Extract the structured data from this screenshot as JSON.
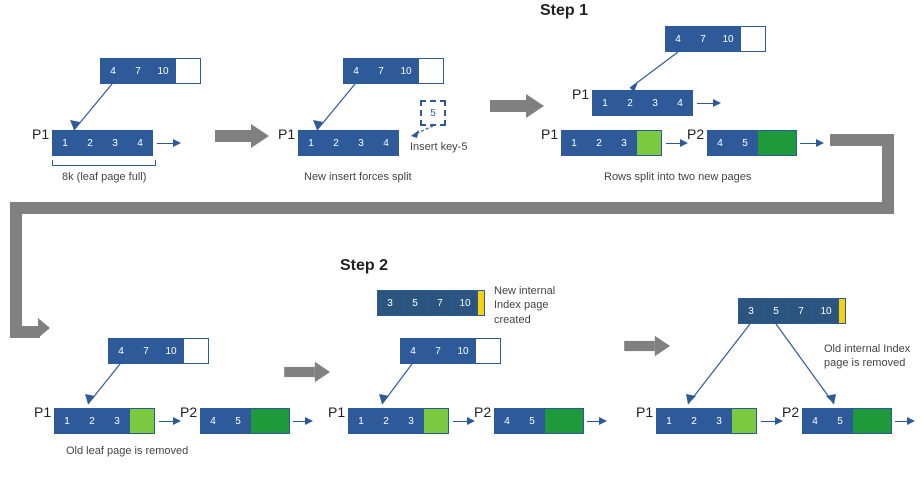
{
  "steps": {
    "step1": "Step 1",
    "step2": "Step 2"
  },
  "captions": {
    "c1": "8k (leaf page full)",
    "c2": "New insert forces split",
    "c3": "Rows split into two new pages",
    "c4": "Old leaf page is removed",
    "c5": "New internal\nIndex page\ncreated",
    "c6": "Old internal Index\npage is removed",
    "insert": "Insert key-5"
  },
  "labels": {
    "p1": "P1",
    "p2": "P2"
  },
  "cells": {
    "idx": {
      "a": "4",
      "b": "7",
      "c": "10"
    },
    "leaf4": {
      "a": "1",
      "b": "2",
      "c": "3",
      "d": "4"
    },
    "dash5": "5",
    "p1_3": {
      "a": "1",
      "b": "2",
      "c": "3"
    },
    "p2_2": {
      "a": "4",
      "b": "5"
    },
    "internal4": {
      "a": "3",
      "b": "5",
      "c": "7",
      "d": "10"
    }
  },
  "chart_data": {
    "type": "diagram",
    "title": "B-tree page split sequence",
    "stages": [
      {
        "group": "Step 1",
        "frames": [
          {
            "caption": "8k (leaf page full)",
            "internal_page": [
              4,
              7,
              10,
              null
            ],
            "leaf_pages": [
              {
                "id": "P1",
                "rows": [
                  1,
                  2,
                  3,
                  4
                ]
              }
            ]
          },
          {
            "caption": "New insert forces split",
            "internal_page": [
              4,
              7,
              10,
              null
            ],
            "leaf_pages": [
              {
                "id": "P1",
                "rows": [
                  1,
                  2,
                  3,
                  4
                ]
              }
            ],
            "pending_insert": 5,
            "note": "Insert key-5"
          },
          {
            "caption": "Rows split into two new pages",
            "internal_page": [
              4,
              7,
              10,
              null
            ],
            "old_leaf": {
              "id": "P1",
              "rows": [
                1,
                2,
                3,
                4
              ]
            },
            "leaf_pages": [
              {
                "id": "P1",
                "rows": [
                  1,
                  2,
                  3,
                  "new"
                ]
              },
              {
                "id": "P2",
                "rows": [
                  4,
                  5,
                  "new",
                  "new"
                ]
              }
            ]
          }
        ]
      },
      {
        "group": "Step 2",
        "frames": [
          {
            "caption": "Old leaf page is removed",
            "internal_page": [
              4,
              7,
              10,
              null
            ],
            "leaf_pages": [
              {
                "id": "P1",
                "rows": [
                  1,
                  2,
                  3,
                  "new"
                ]
              },
              {
                "id": "P2",
                "rows": [
                  4,
                  5,
                  "new",
                  "new"
                ]
              }
            ]
          },
          {
            "caption": "New internal Index page created",
            "new_internal_page": [
              3,
              5,
              7,
              10,
              "new"
            ],
            "old_internal_page": [
              4,
              7,
              10,
              null
            ],
            "leaf_pages": [
              {
                "id": "P1",
                "rows": [
                  1,
                  2,
                  3,
                  "new"
                ]
              },
              {
                "id": "P2",
                "rows": [
                  4,
                  5,
                  "new",
                  "new"
                ]
              }
            ]
          },
          {
            "caption": "Old internal Index page is removed",
            "internal_page": [
              3,
              5,
              7,
              10,
              "new"
            ],
            "leaf_pages": [
              {
                "id": "P1",
                "rows": [
                  1,
                  2,
                  3,
                  "new"
                ]
              },
              {
                "id": "P2",
                "rows": [
                  4,
                  5,
                  "new",
                  "new"
                ]
              }
            ]
          }
        ]
      }
    ]
  }
}
